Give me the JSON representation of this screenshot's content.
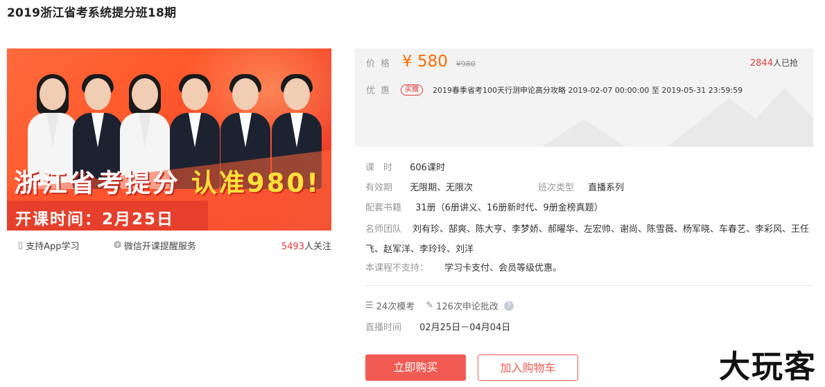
{
  "page": {
    "title": "2019浙江省考系统提分班18期"
  },
  "banner": {
    "slogan_a": "浙江省考提分",
    "slogan_b": "认准980!",
    "open_time": "开课时间：2月25日"
  },
  "features": {
    "app": "支持App学习",
    "wechat": "微信开课提醒服务",
    "follow_count": "5493",
    "follow_suffix": "人关注"
  },
  "price": {
    "label": "价格",
    "current": "¥ 580",
    "original": "¥980",
    "sold_count": "2844",
    "sold_suffix": "人已抢"
  },
  "promo": {
    "label": "优惠",
    "tag": "买赠",
    "text": "2019春季省考100天行测申论高分攻略 2019-02-07 00:00:00 至 2019-05-31 23:59:59"
  },
  "details": {
    "hours_label": "课　时",
    "hours_value": "606课时",
    "validity_label": "有效期",
    "validity_value": "无限期、无限次",
    "class_type_label": "班次类型",
    "class_type_value": "直播系列",
    "books_label": "配套书籍",
    "books_value": "31册（6册讲义、16册新时代、9册金榜真题）",
    "teachers_label": "名师团队",
    "teachers_value": "刘有珍、郜爽、陈大亨、李梦娇、郝曜华、左宏帅、谢尚、陈雪薇、杨军晓、车春艺、李彩风、王任飞、赵军洋、李玲玲、刘洋",
    "unsupported_label": "本课程不支持：",
    "unsupported_value": "学习卡支付、会员等级优惠。"
  },
  "stats": {
    "mock": "24次模考",
    "essay": "126次申论批改",
    "live_label": "直播时间",
    "live_value": "02月25日－04月04日"
  },
  "buttons": {
    "buy": "立即购买",
    "cart": "加入购物车"
  },
  "watermark": "大玩客",
  "icons": {
    "app": "phone-icon",
    "wechat": "wechat-icon",
    "mock": "exam-icon",
    "essay": "essay-edit-icon",
    "help": "question-icon"
  },
  "colors": {
    "price": "#ff6a00",
    "accent": "#e4393c",
    "button": "#f25b53"
  }
}
